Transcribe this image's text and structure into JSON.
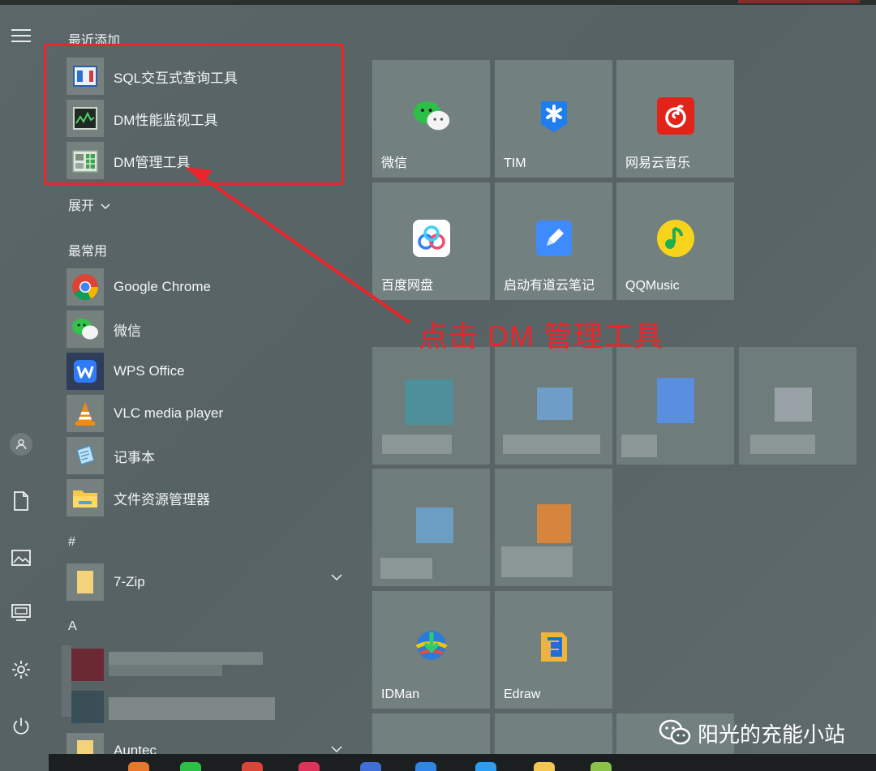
{
  "sections": {
    "recent": "最近添加",
    "expand": "展开",
    "frequent": "最常用",
    "hash": "#",
    "letter_a": "A"
  },
  "recent_apps": [
    {
      "label": "SQL交互式查询工具",
      "icon": "sql-icon"
    },
    {
      "label": "DM性能监视工具",
      "icon": "monitor-icon"
    },
    {
      "label": "DM管理工具",
      "icon": "manager-icon"
    }
  ],
  "frequent_apps": [
    {
      "label": "Google Chrome",
      "icon": "chrome-icon"
    },
    {
      "label": "微信",
      "icon": "wechat-icon"
    },
    {
      "label": "WPS Office",
      "icon": "wps-icon"
    },
    {
      "label": "VLC media player",
      "icon": "vlc-icon"
    },
    {
      "label": "记事本",
      "icon": "notepad-icon"
    },
    {
      "label": "文件资源管理器",
      "icon": "folder-icon"
    }
  ],
  "alpha_apps": [
    {
      "label": "7-Zip",
      "icon": "folder-icon"
    },
    {
      "label": "Auntec",
      "icon": "folder-icon"
    }
  ],
  "annotation": "点击 DM 管理工具",
  "tiles": [
    {
      "label": "微信",
      "icon": "wechat-icon"
    },
    {
      "label": "TIM",
      "icon": "tim-icon"
    },
    {
      "label": "网易云音乐",
      "icon": "netease-music-icon"
    },
    {
      "label": "百度网盘",
      "icon": "baidu-netdisk-icon"
    },
    {
      "label": "启动有道云笔记",
      "icon": "youdao-note-icon"
    },
    {
      "label": "QQMusic",
      "icon": "qqmusic-icon"
    },
    {
      "label": "IDMan",
      "icon": "idman-icon"
    },
    {
      "label": "Edraw",
      "icon": "edraw-icon"
    }
  ],
  "watermark": "阳光的充能小站",
  "colors": {
    "annotation_red": "#e8262b",
    "tile_bg": "#72807f",
    "background": "#5a6668"
  }
}
